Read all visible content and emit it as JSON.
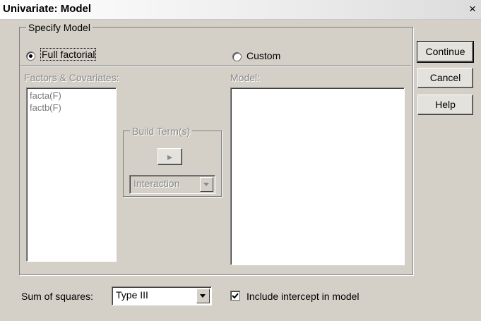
{
  "window": {
    "title": "Univariate: Model",
    "close_glyph": "×"
  },
  "buttons": {
    "continue": "Continue",
    "cancel": "Cancel",
    "help": "Help"
  },
  "specify_model": {
    "legend": "Specify Model",
    "full_factorial": {
      "label": "Full factorial",
      "selected": true
    },
    "custom": {
      "label": "Custom",
      "selected": false
    }
  },
  "factors": {
    "label": "Factors & Covariates:",
    "items": [
      "facta(F)",
      "factb(F)"
    ]
  },
  "model": {
    "label": "Model:",
    "items": []
  },
  "build_term": {
    "legend": "Build Term(s)",
    "arrow": "▸",
    "type_value": "Interaction"
  },
  "sum_of_squares": {
    "label": "Sum of squares:",
    "value": "Type III"
  },
  "intercept": {
    "label": "Include intercept in model",
    "checked": true
  }
}
